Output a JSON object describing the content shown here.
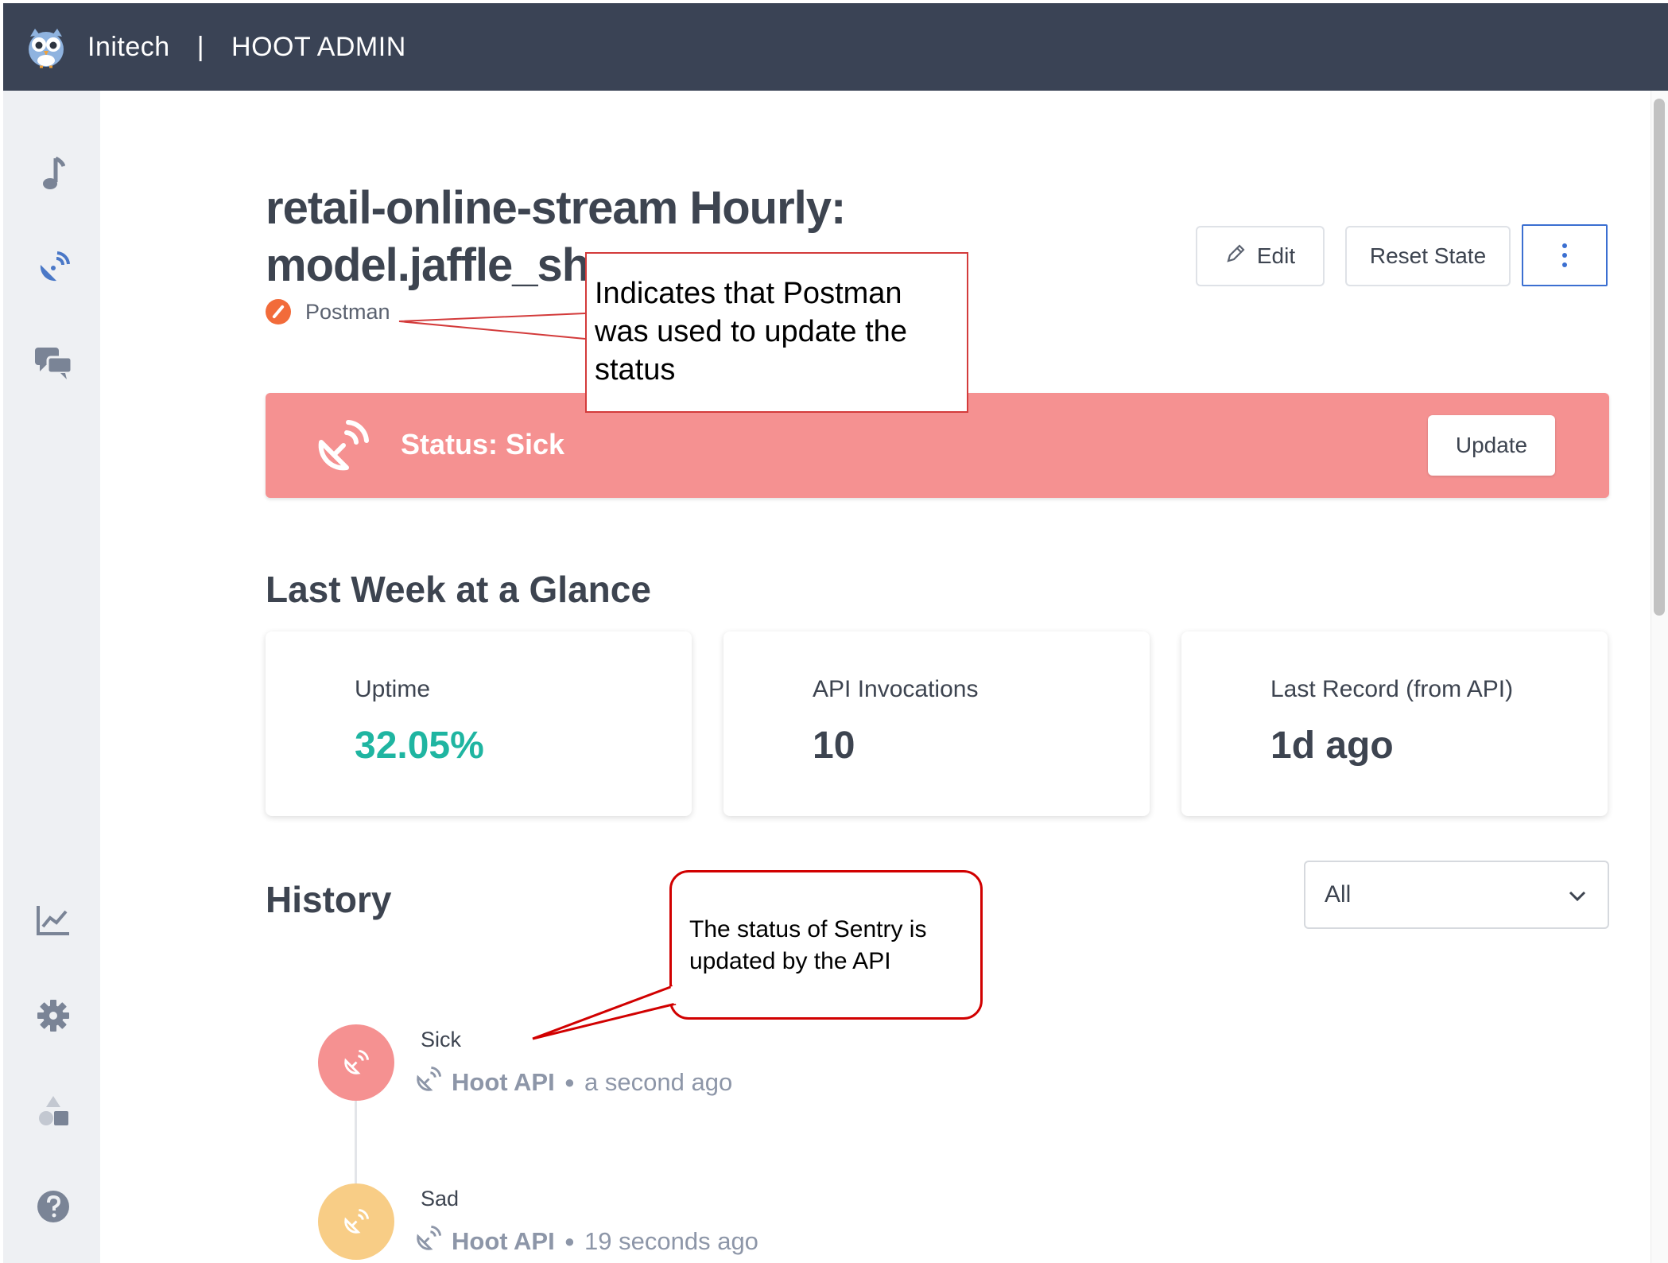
{
  "header": {
    "org_name": "Initech",
    "separator": "|",
    "app_name": "HOOT ADMIN"
  },
  "sidebar": {
    "items": [
      {
        "icon": "music-note-icon"
      },
      {
        "icon": "satellite-dish-icon"
      },
      {
        "icon": "chat-bubbles-icon"
      },
      {
        "icon": "line-chart-icon"
      },
      {
        "icon": "gear-icon"
      },
      {
        "icon": "shapes-icon"
      },
      {
        "icon": "help-icon"
      }
    ]
  },
  "page": {
    "title_line1": "retail-online-stream Hourly:",
    "title_line2": "model.jaffle_sho",
    "integration_name": "Postman"
  },
  "toolbar": {
    "edit_label": "Edit",
    "reset_label": "Reset State"
  },
  "status": {
    "text": "Status: Sick",
    "update_label": "Update",
    "color": "#f59191"
  },
  "glance": {
    "heading": "Last Week at a Glance",
    "cards": [
      {
        "label": "Uptime",
        "value": "32.05%"
      },
      {
        "label": "API Invocations",
        "value": "10"
      },
      {
        "label": "Last Record (from API)",
        "value": "1d ago"
      }
    ]
  },
  "history": {
    "heading": "History",
    "filter_value": "All",
    "entries": [
      {
        "status": "Sick",
        "source": "Hoot API",
        "time": "a second ago"
      },
      {
        "status": "Sad",
        "source": "Hoot API",
        "time": "19 seconds ago"
      }
    ]
  },
  "annotations": {
    "postman_note": [
      "Indicates that Postman",
      "was used to update the",
      "status"
    ],
    "api_note": [
      "The status of Sentry is",
      "updated by the API"
    ]
  },
  "colors": {
    "header_bg": "#3a4355",
    "sidebar_bg": "#eef0f3",
    "accent_blue": "#3b6fd1",
    "uptime_green": "#1fb5a1",
    "sad_yellow": "#f8cd86",
    "annotation_red": "#d10000"
  }
}
